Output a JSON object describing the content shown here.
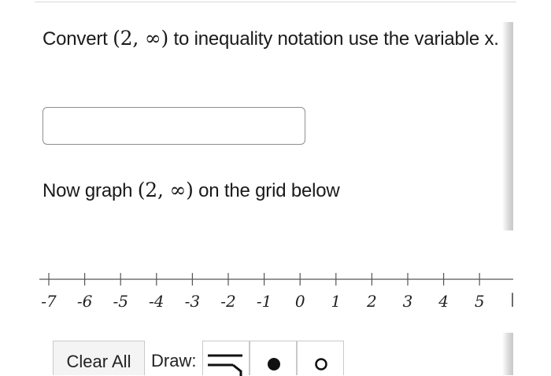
{
  "question": {
    "prefix": "Convert",
    "interval": "(2, ∞)",
    "suffix": " to inequality notation use the variable x."
  },
  "answer_input": {
    "value": "",
    "placeholder": ""
  },
  "graph_prompt": {
    "prefix": "Now graph",
    "interval": "(2, ∞)",
    "suffix": " on the grid below"
  },
  "number_line": {
    "ticks": [
      "-7",
      "-6",
      "-5",
      "-4",
      "-3",
      "-2",
      "-1",
      "0",
      "1",
      "2",
      "3",
      "4",
      "5"
    ]
  },
  "toolbar": {
    "clear_label": "Clear All",
    "draw_label": "Draw:",
    "tools": [
      "ray-tool-icon",
      "closed-dot-icon",
      "open-dot-icon"
    ]
  }
}
